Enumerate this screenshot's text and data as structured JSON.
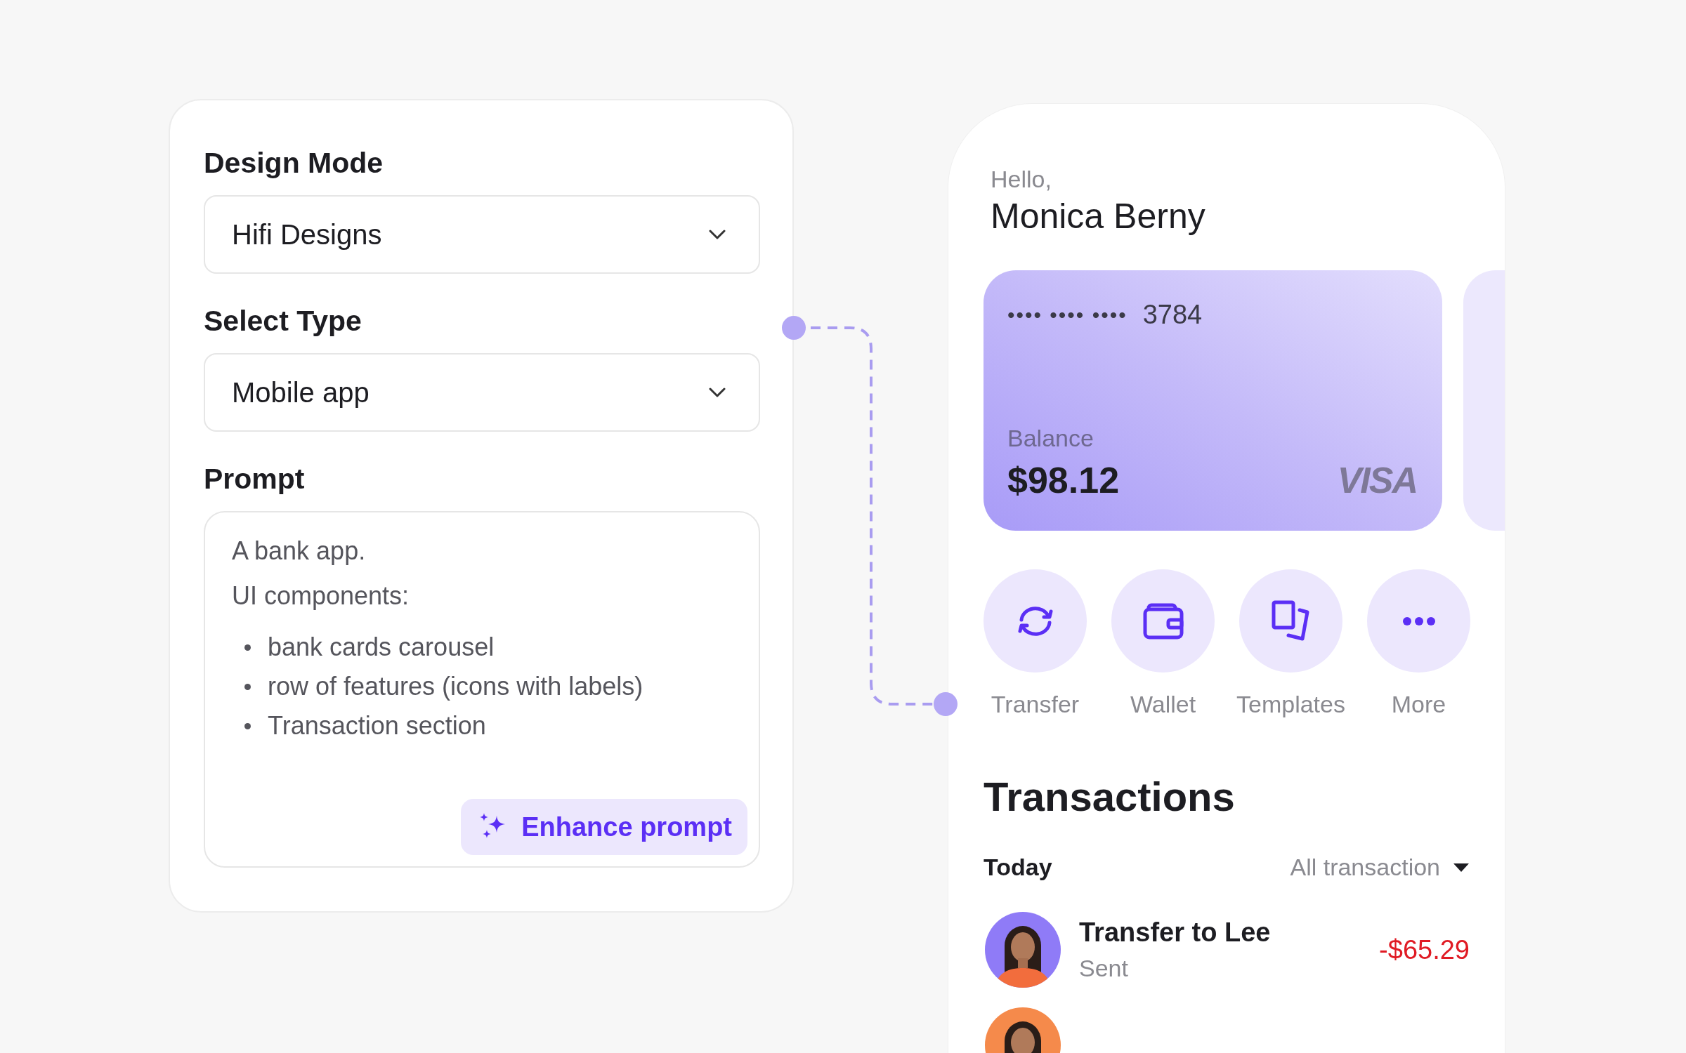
{
  "form": {
    "fields": [
      {
        "label": "Design Mode",
        "kind": "select",
        "value": "Hifi Designs"
      },
      {
        "label": "Select Type",
        "kind": "select",
        "value": "Mobile app"
      },
      {
        "label": "Prompt",
        "kind": "textarea",
        "lines": [
          "A bank app.",
          "UI components:"
        ],
        "bullets": [
          "bank cards carousel",
          "row of features (icons with labels)",
          "Transaction section"
        ],
        "action": "Enhance prompt"
      }
    ]
  },
  "app": {
    "greeting": "Hello,",
    "user": "Monica Berny",
    "card": {
      "masked": "•••• •••• ••••",
      "last4": "3784",
      "balance_label": "Balance",
      "balance": "$98.12",
      "brand": "VISA"
    },
    "actions": [
      {
        "label": "Transfer",
        "kind": "transfer"
      },
      {
        "label": "Wallet",
        "kind": "wallet"
      },
      {
        "label": "Templates",
        "kind": "templates"
      },
      {
        "label": "More",
        "kind": "more"
      }
    ],
    "transactions_title": "Transactions",
    "group": "Today",
    "filter": "All transaction",
    "transactions": [
      {
        "kind": "row",
        "title": "Transfer to Lee",
        "status": "Sent",
        "amount": "-$65.29"
      },
      {
        "kind": "picture"
      }
    ]
  }
}
